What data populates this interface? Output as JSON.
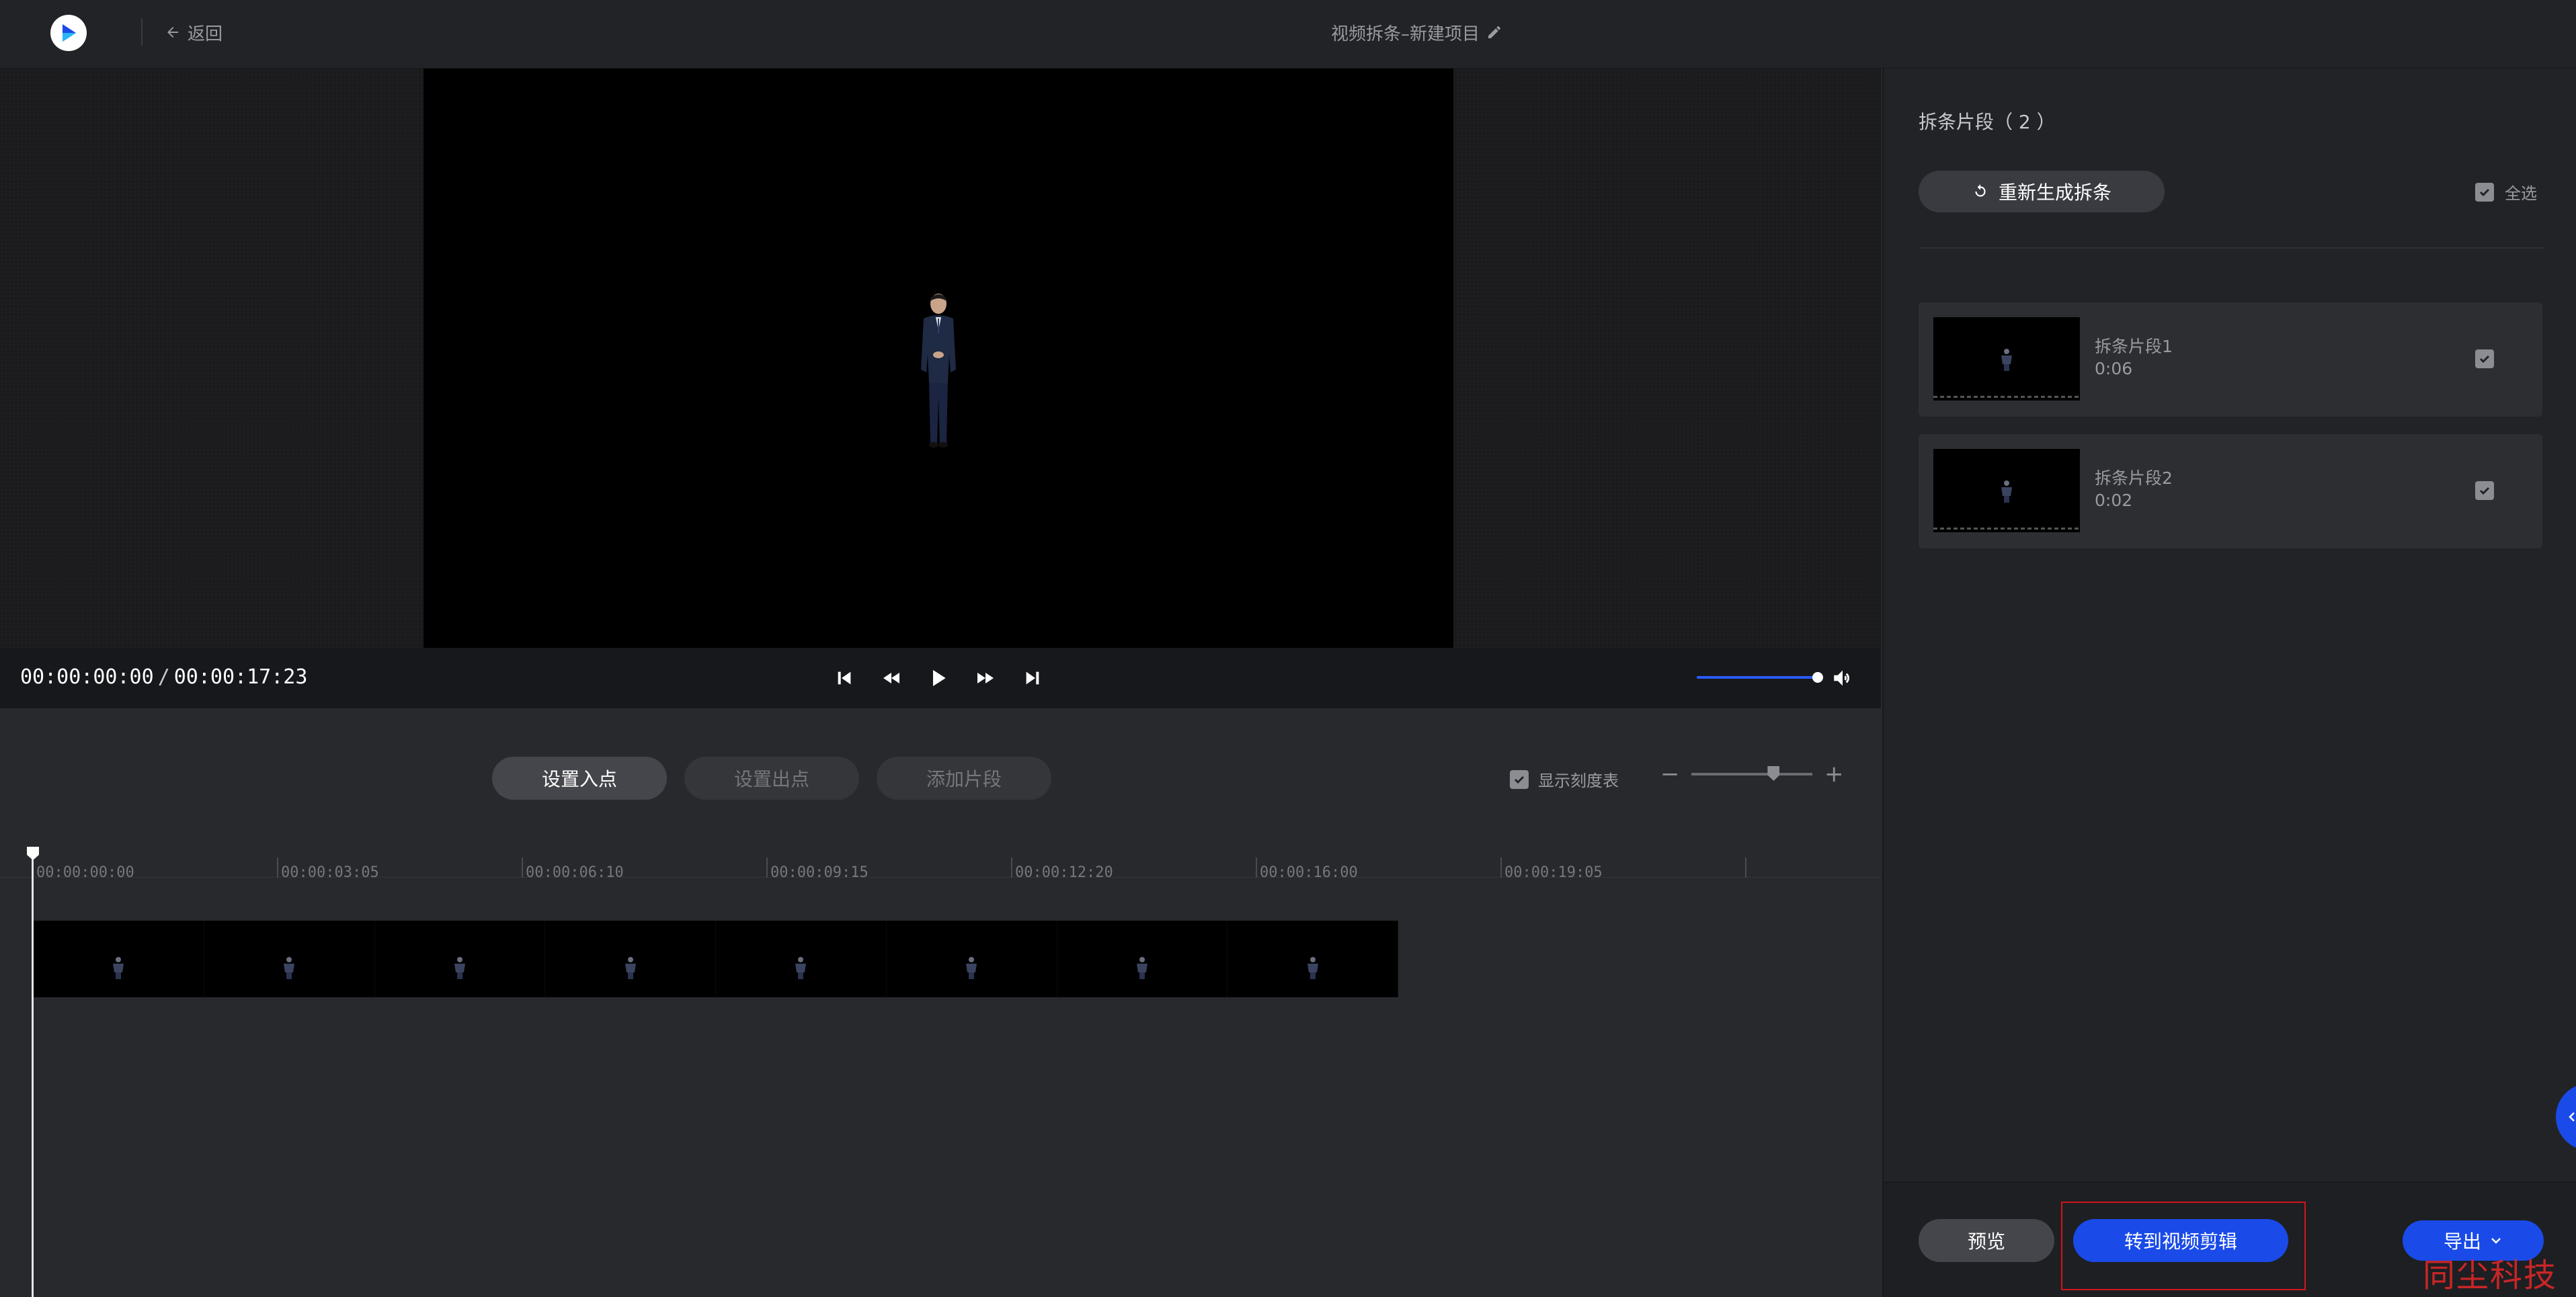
{
  "header": {
    "back_label": "返回",
    "project_title": "视频拆条–新建项目"
  },
  "player": {
    "current_time": "00:00:00:00",
    "separator": "/",
    "total_time": "00:00:17:23",
    "volume_level_percent": 100
  },
  "editbar": {
    "set_in": "设置入点",
    "set_out": "设置出点",
    "add_clip": "添加片段",
    "show_scale_label": "显示刻度表",
    "show_scale_checked": true,
    "zoom_minus": "−",
    "zoom_plus": "+",
    "zoom_level_percent": 68
  },
  "timeline": {
    "ticks": [
      "00:00:00:00",
      "00:00:03:05",
      "00:00:06:10",
      "00:00:09:15",
      "00:00:12:20",
      "00:00:16:00",
      "00:00:19:05"
    ],
    "frame_count": 8
  },
  "right_panel": {
    "title": "拆条片段（ 2 ）",
    "regenerate_label": "重新生成拆条",
    "select_all_label": "全选",
    "select_all_checked": true,
    "clips": [
      {
        "name": "拆条片段1",
        "duration": "0:06",
        "checked": true
      },
      {
        "name": "拆条片段2",
        "duration": "0:02",
        "checked": true
      }
    ],
    "preview_label": "预览",
    "goto_editor_label": "转到视频剪辑",
    "export_label": "导出"
  },
  "watermark": "同尘科技",
  "colors": {
    "accent": "#1a4be8",
    "highlight_box": "#d0151b",
    "watermark": "#e62828"
  }
}
